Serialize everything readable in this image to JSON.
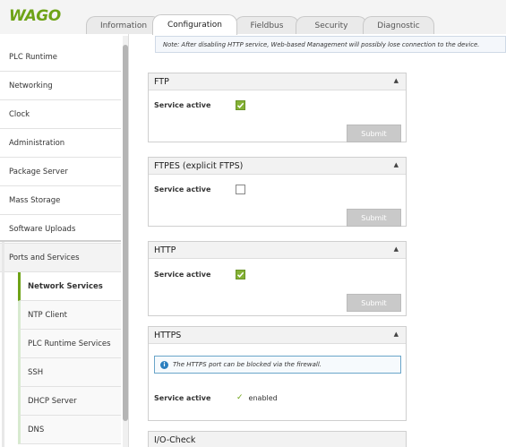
{
  "logo": "WAGO",
  "tabs": [
    {
      "label": "Information"
    },
    {
      "label": "Configuration",
      "active": true
    },
    {
      "label": "Fieldbus"
    },
    {
      "label": "Security"
    },
    {
      "label": "Diagnostic"
    }
  ],
  "sidebar": {
    "items": [
      {
        "label": "PLC Runtime"
      },
      {
        "label": "Networking"
      },
      {
        "label": "Clock"
      },
      {
        "label": "Administration"
      },
      {
        "label": "Package Server"
      },
      {
        "label": "Mass Storage"
      },
      {
        "label": "Software Uploads"
      },
      {
        "label": "Ports and Services",
        "expanded": true
      }
    ],
    "subitems": [
      {
        "label": "Network Services",
        "selected": true
      },
      {
        "label": "NTP Client"
      },
      {
        "label": "PLC Runtime Services"
      },
      {
        "label": "SSH"
      },
      {
        "label": "DHCP Server"
      },
      {
        "label": "DNS"
      }
    ]
  },
  "note": "Note: After disabling HTTP service, Web-based Management will possibly lose connection to the device.",
  "panels": {
    "ftp": {
      "title": "FTP",
      "service_label": "Service active",
      "checked": true,
      "submit": "Submit",
      "caret_icon": "chevron-up-icon"
    },
    "ftpes": {
      "title": "FTPES (explicit FTPS)",
      "service_label": "Service active",
      "checked": false,
      "submit": "Submit",
      "caret_icon": "chevron-up-icon"
    },
    "http": {
      "title": "HTTP",
      "service_label": "Service active",
      "checked": true,
      "submit": "Submit",
      "caret_icon": "chevron-up-icon"
    },
    "https": {
      "title": "HTTPS",
      "info": "The HTTPS port can be blocked via the firewall.",
      "service_label": "Service active",
      "status": "enabled",
      "caret_icon": "chevron-up-icon"
    },
    "iocheck": {
      "title": "I/O-Check"
    }
  },
  "colors": {
    "brand": "#6ea317",
    "check": "#84b135",
    "info": "#2b7fbf"
  }
}
